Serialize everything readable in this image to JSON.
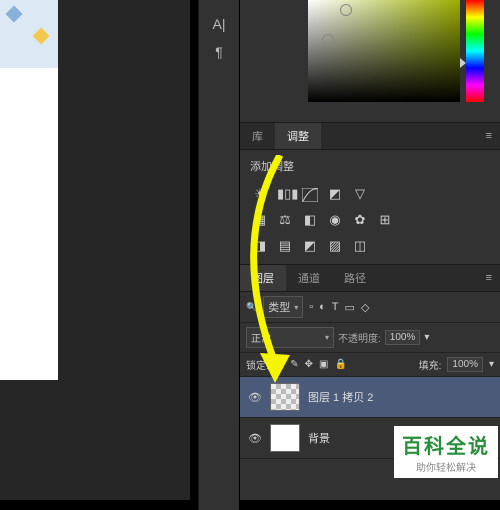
{
  "toolbar": {
    "text_tool": "A|",
    "paragraph": "¶"
  },
  "tabs": {
    "library": "库",
    "adjustments": "调整",
    "layers": "图层",
    "channels": "通道",
    "paths": "路径"
  },
  "adjustments": {
    "title": "添加调整"
  },
  "layers_panel": {
    "kind_label": "类型",
    "blend_mode": "正常",
    "opacity_label": "不透明度:",
    "opacity_value": "100%",
    "lock_label": "锁定:",
    "fill_label": "填充:",
    "fill_value": "100%",
    "layer1_name": "图层 1 拷贝 2",
    "bg_name": "背景"
  },
  "watermark": {
    "line1": "百科全说",
    "line2": "助你轻松解决"
  }
}
